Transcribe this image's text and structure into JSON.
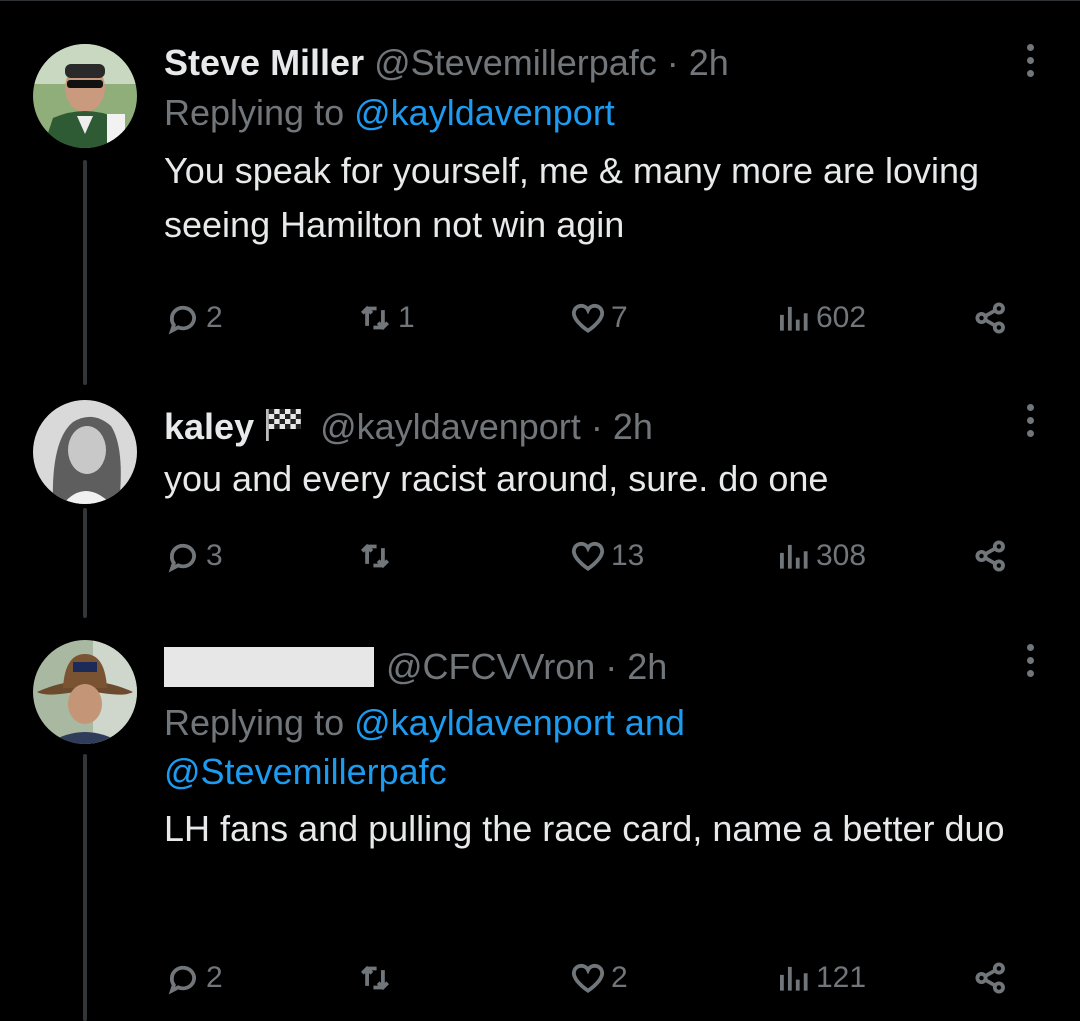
{
  "tweets": [
    {
      "name": "Steve Miller",
      "handle": "@Stevemillerpafc",
      "dot": "·",
      "time": "2h",
      "replying_prefix": "Replying to",
      "replying_to": "@kayldavenport",
      "body": "You speak for yourself, me & many more are loving seeing Hamilton not win agin",
      "replies": "2",
      "retweets": "1",
      "likes": "7",
      "views": "602"
    },
    {
      "name": "kaley",
      "name_emoji": "checkered-flag-icon",
      "handle": "@kayldavenport",
      "dot": "·",
      "time": "2h",
      "body": "you and every racist around, sure. do one",
      "replies": "3",
      "retweets": "",
      "likes": "13",
      "views": "308"
    },
    {
      "name": "",
      "handle": "@CFCVVron",
      "dot": "·",
      "time": "2h",
      "replying_prefix": "Replying to",
      "replying_to": "@kayldavenport and",
      "replying_to_2": "@Stevemillerpafc",
      "body": "LH fans and pulling the race card, name a better duo",
      "replies": "2",
      "retweets": "",
      "likes": "2",
      "views": "121"
    }
  ],
  "colors": {
    "background": "#000000",
    "text": "#e7e9ea",
    "secondary": "#71767b",
    "link": "#1d9bf0",
    "redaction": "#e7e7e7"
  }
}
